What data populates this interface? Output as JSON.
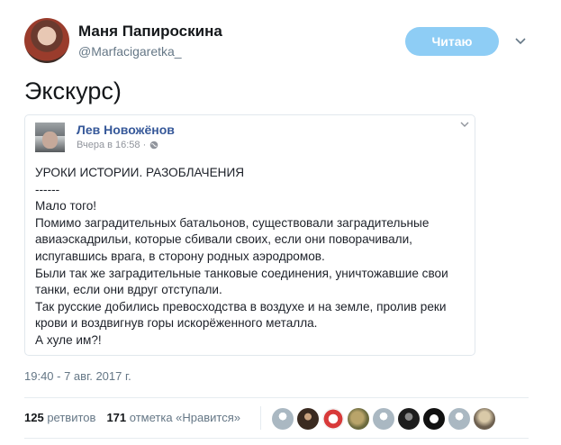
{
  "tweet": {
    "author_name": "Маня Папироскина",
    "author_handle": "@Marfacigaretka_",
    "follow_label": "Читаю",
    "text": "Экскурс)",
    "timestamp": "19:40 - 7 авг. 2017 г.",
    "retweets_count": "125",
    "retweets_label": "ретвитов",
    "likes_count": "171",
    "likes_label": "отметка «Нравится»"
  },
  "quote": {
    "author_name": "Лев Новожёнов",
    "time": "Вчера в 16:58 ·",
    "lines": [
      "УРОКИ ИСТОРИИ. РАЗОБЛАЧЕНИЯ",
      "------",
      "Мало того!",
      "Помимо заградительных батальонов, существовали заградительные",
      "авиаэскадрильи, которые сбивали своих, если они поворачивали,",
      "испугавшись врага, в сторону родных аэродромов.",
      "Были так же заградительные танковые соединения, уничтожавшие свои",
      "танки, если они вдруг отступали.",
      "Так русские добились превосходства в воздухе и на земле, пролив реки",
      "крови и воздвигнув горы искорёженного металла.",
      "А хуле им?!"
    ]
  },
  "liker_avatars": [
    "default-avatar",
    "photo-avatar",
    "photo-avatar",
    "photo-avatar",
    "default-avatar",
    "photo-avatar",
    "photo-avatar",
    "default-avatar",
    "photo-avatar"
  ],
  "colors": {
    "follow_button": "#8ecdf5",
    "quote_name": "#365899",
    "secondary_text": "#657786"
  }
}
